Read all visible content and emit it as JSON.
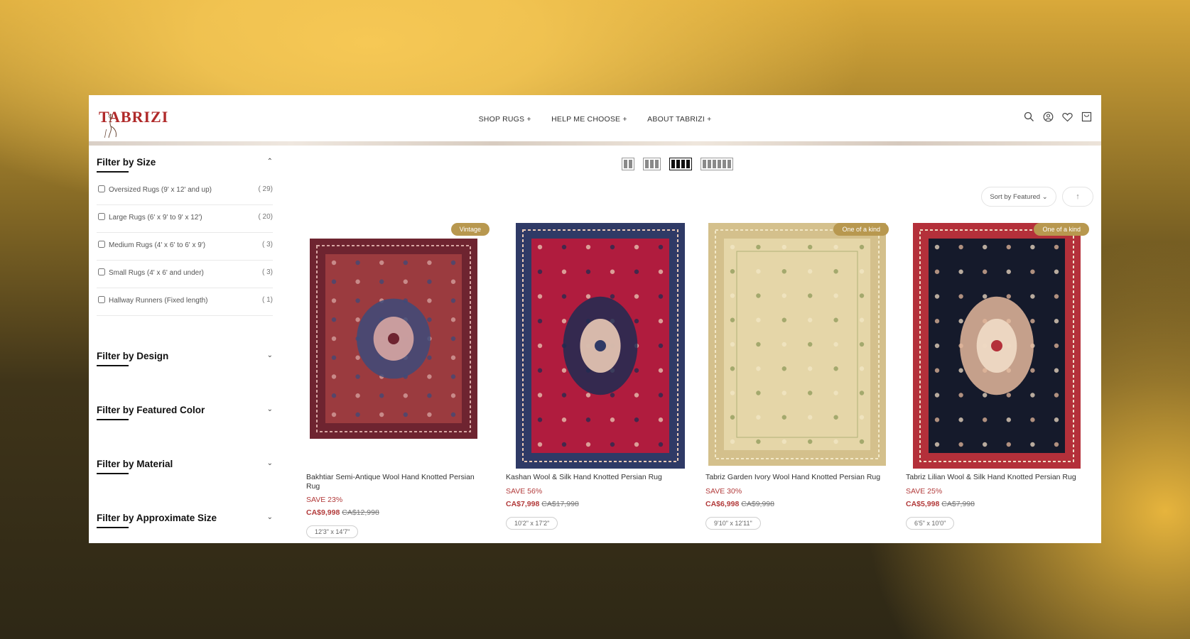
{
  "brand": {
    "logo_text": "TABRIZI"
  },
  "nav": [
    "SHOP RUGS +",
    "HELP ME CHOOSE +",
    "ABOUT TABRIZI +"
  ],
  "header_icons": [
    "search-icon",
    "account-icon",
    "wishlist-heart-icon",
    "cart-icon"
  ],
  "sidebar": {
    "size_filter": {
      "title": "Filter by Size",
      "expanded": true,
      "options": [
        {
          "label": "Oversized Rugs (9' x 12' and up)",
          "count": "( 29)"
        },
        {
          "label": "Large Rugs (6' x 9' to 9' x 12')",
          "count": "( 20)"
        },
        {
          "label": "Medium Rugs (4' x 6' to 6' x 9')",
          "count": "( 3)"
        },
        {
          "label": "Small Rugs (4' x 6' and under)",
          "count": "( 3)"
        },
        {
          "label": "Hallway Runners (Fixed length)",
          "count": "( 1)"
        }
      ]
    },
    "collapsed_filters": [
      "Filter by Design",
      "Filter by Featured Color",
      "Filter by Material",
      "Filter by Approximate Size"
    ]
  },
  "toolbar": {
    "grid_options": [
      2,
      3,
      4,
      6
    ],
    "active_grid": 4,
    "sort_label": "Sort by Featured",
    "scroll_top_symbol": "↑"
  },
  "products": [
    {
      "badge": "Vintage",
      "name": "Bakhtiar Semi-Antique Wool Hand Knotted Persian Rug",
      "save": "SAVE 23%",
      "price": "CA$9,998",
      "was": "CA$12,998",
      "size": "12'3\" x 14'7\"",
      "palette": {
        "field": "#9b3b3f",
        "border": "#6e2430",
        "accent": "#3d4b7a",
        "light": "#d7a6a3"
      }
    },
    {
      "badge": "",
      "name": "Kashan Wool & Silk Hand Knotted Persian Rug",
      "save": "SAVE 56%",
      "price": "CA$7,998",
      "was": "CA$17,998",
      "size": "10'2\" x 17'2\"",
      "palette": {
        "field": "#b01c3e",
        "border": "#2f3a66",
        "accent": "#1f2c52",
        "light": "#e9c9b5"
      }
    },
    {
      "badge": "One of a kind",
      "name": "Tabriz Garden Ivory Wool Hand Knotted Persian Rug",
      "save": "SAVE 30%",
      "price": "CA$6,998",
      "was": "CA$9,998",
      "size": "9'10\" x 12'11\"",
      "palette": {
        "field": "#e5d6a8",
        "border": "#d4c08c",
        "accent": "#8e9a5a",
        "light": "#f1e7c6"
      }
    },
    {
      "badge": "One of a kind",
      "name": "Tabriz Lilian Wool & Silk Hand Knotted Persian Rug",
      "save": "SAVE 25%",
      "price": "CA$5,998",
      "was": "CA$7,998",
      "size": "6'5\" x 10'0\"",
      "palette": {
        "field": "#151a2b",
        "border": "#b4303a",
        "accent": "#e4b89c",
        "light": "#efdcc6"
      }
    }
  ],
  "colors": {
    "accent_red": "#b23a3a",
    "badge_gold": "#b8984f",
    "brand_red": "#b02a2a"
  }
}
